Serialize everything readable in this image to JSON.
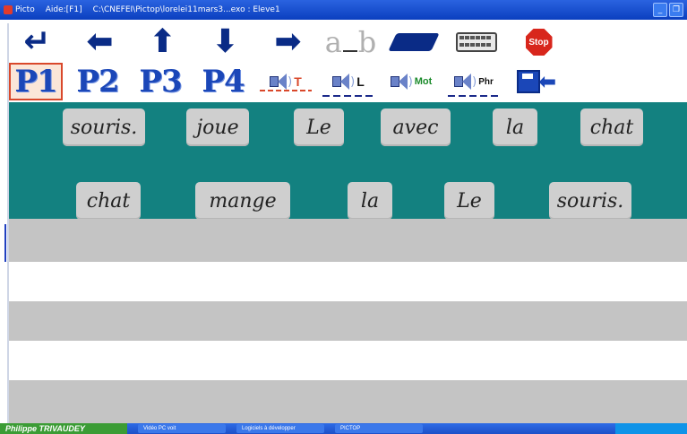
{
  "window": {
    "app_name": "Picto",
    "help": "Aide:[F1]",
    "path": "C:\\CNEFEI\\Pictop\\lorelei11mars3...exo : Eleve1"
  },
  "toolbar1": {
    "items": [
      {
        "name": "enter-icon",
        "glyph": "↵"
      },
      {
        "name": "arrow-left-icon",
        "glyph": "⬅"
      },
      {
        "name": "arrow-up-icon",
        "glyph": "⬆"
      },
      {
        "name": "arrow-down-icon",
        "glyph": "⬇"
      },
      {
        "name": "arrow-right-icon",
        "glyph": "➡"
      }
    ],
    "ab_a": "a",
    "ab_b": "b",
    "stop_label": "Stop"
  },
  "toolbar2": {
    "pages": [
      "P1",
      "P2",
      "P3",
      "P4"
    ],
    "selected_page": "P1",
    "speak_letters": "T",
    "speak_l": "L",
    "speak_mot": "Mot",
    "speak_phr": "Phr"
  },
  "word_bank": {
    "row1": [
      "souris.",
      "joue",
      "Le",
      "avec",
      "la",
      "chat"
    ],
    "row2": [
      "chat",
      "mange",
      "la",
      "Le",
      "souris."
    ]
  },
  "taskbar": {
    "user": "Philippe TRIVAUDEY",
    "tasks": [
      "Vidéo PC voit",
      "Logiciels à développer",
      "PICTOP"
    ]
  },
  "colors": {
    "bank_bg": "#138180",
    "word_tile": "#cfcfcf",
    "line_gray": "#c4c4c4",
    "accent_blue": "#1b47b8"
  }
}
